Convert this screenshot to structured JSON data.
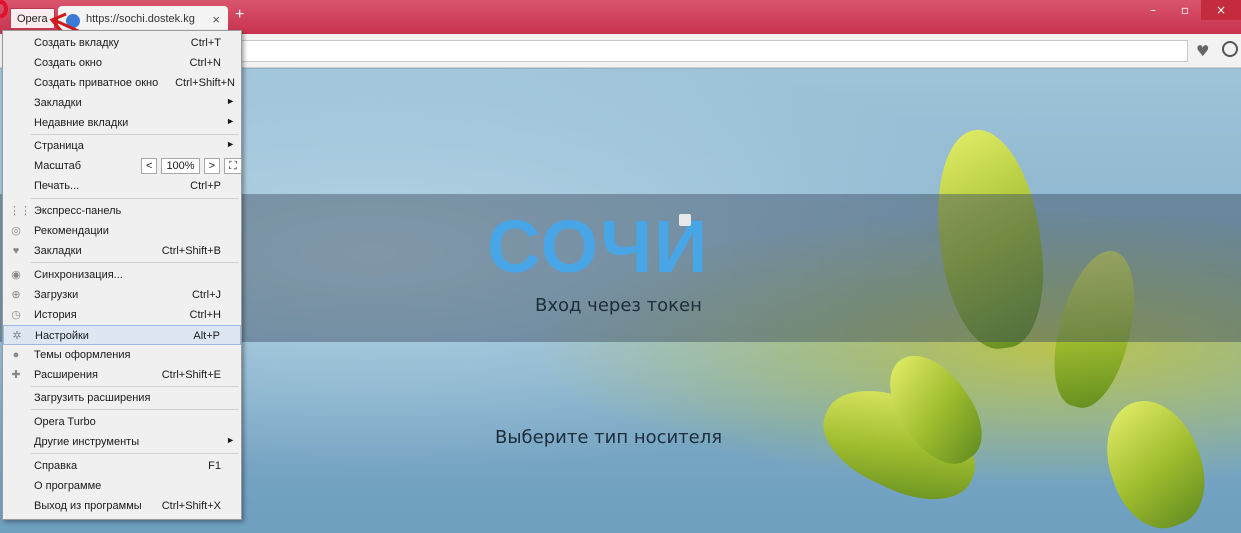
{
  "titlebar": {
    "opera_button": "Opera",
    "tab_title": "https://sochi.dostek.kg",
    "tab_close": "×",
    "new_tab": "+",
    "controls": [
      "–",
      "▫",
      "×"
    ]
  },
  "page": {
    "logo": "СОЧИ",
    "token_text": "Вход через токен",
    "choose_text": "Выберите тип носителя"
  },
  "menu": {
    "items": [
      {
        "label": "Создать вкладку",
        "shortcut": "Ctrl+T"
      },
      {
        "label": "Создать окно",
        "shortcut": "Ctrl+N"
      },
      {
        "label": "Создать приватное окно",
        "shortcut": "Ctrl+Shift+N"
      },
      {
        "label": "Закладки",
        "shortcut": ""
      },
      {
        "label": "Недавние вкладки",
        "shortcut": ""
      },
      {
        "label": "Страница",
        "shortcut": ""
      },
      {
        "label": "Масштаб",
        "shortcut": ""
      },
      {
        "label": "Печать...",
        "shortcut": "Ctrl+P"
      },
      {
        "label": "Экспресс-панель",
        "shortcut": ""
      },
      {
        "label": "Рекомендации",
        "shortcut": ""
      },
      {
        "label": "Закладки",
        "shortcut": "Ctrl+Shift+B"
      },
      {
        "label": "Синхронизация...",
        "shortcut": ""
      },
      {
        "label": "Загрузки",
        "shortcut": "Ctrl+J"
      },
      {
        "label": "История",
        "shortcut": "Ctrl+H"
      },
      {
        "label": "Настройки",
        "shortcut": "Alt+P"
      },
      {
        "label": "Темы оформления",
        "shortcut": ""
      },
      {
        "label": "Расширения",
        "shortcut": "Ctrl+Shift+E"
      },
      {
        "label": "Загрузить расширения",
        "shortcut": ""
      },
      {
        "label": "Opera Turbo",
        "shortcut": ""
      },
      {
        "label": "Другие инструменты",
        "shortcut": ""
      },
      {
        "label": "Справка",
        "shortcut": "F1"
      },
      {
        "label": "О программе",
        "shortcut": ""
      },
      {
        "label": "Выход из программы",
        "shortcut": "Ctrl+Shift+X"
      }
    ],
    "zoom": {
      "minus": "<",
      "value": "100%",
      "plus": ">",
      "fullscreen": "⛶"
    }
  },
  "icons": {
    "speed_dial": "grid-icon",
    "recommend": "eye-icon",
    "bookmarks": "heart-icon",
    "sync": "user-icon",
    "downloads": "download-icon",
    "history": "clock-icon",
    "settings": "gear-icon",
    "themes": "drop-icon",
    "extensions": "puzzle-icon"
  },
  "colors": {
    "accent": "#c8334f",
    "logo": "#48a6e6",
    "highlight": "#dde7f4"
  }
}
